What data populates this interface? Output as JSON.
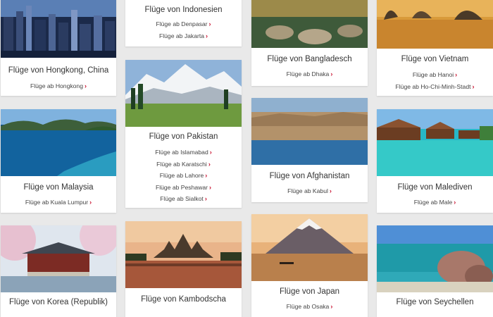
{
  "accent_color": "#c8102e",
  "cards": {
    "hongkong": {
      "title": "Flüge von Hongkong, China",
      "links": [
        {
          "label": "Flüge ab Hongkong",
          "icon": "chevron-right-icon"
        }
      ]
    },
    "indonesien": {
      "title": "Flüge von Indonesien",
      "links": [
        {
          "label": "Flüge ab Denpasar",
          "icon": "chevron-right-icon"
        },
        {
          "label": "Flüge ab Jakarta",
          "icon": "chevron-right-icon"
        }
      ]
    },
    "bangladesch": {
      "title": "Flüge von Bangladesch",
      "links": [
        {
          "label": "Flüge ab Dhaka",
          "icon": "chevron-right-icon"
        }
      ]
    },
    "vietnam": {
      "title": "Flüge von Vietnam",
      "links": [
        {
          "label": "Flüge ab Hanoi",
          "icon": "chevron-right-icon"
        },
        {
          "label": "Flüge ab Ho-Chi-Minh-Stadt",
          "icon": "chevron-right-icon"
        }
      ]
    },
    "malaysia": {
      "title": "Flüge von Malaysia",
      "links": [
        {
          "label": "Flüge ab Kuala Lumpur",
          "icon": "chevron-right-icon"
        }
      ]
    },
    "pakistan": {
      "title": "Flüge von Pakistan",
      "links": [
        {
          "label": "Flüge ab Islamabad",
          "icon": "chevron-right-icon"
        },
        {
          "label": "Flüge ab Karatschi",
          "icon": "chevron-right-icon"
        },
        {
          "label": "Flüge ab Lahore",
          "icon": "chevron-right-icon"
        },
        {
          "label": "Flüge ab Peshawar",
          "icon": "chevron-right-icon"
        },
        {
          "label": "Flüge ab Sialkot",
          "icon": "chevron-right-icon"
        }
      ]
    },
    "afghanistan": {
      "title": "Flüge von Afghanistan",
      "links": [
        {
          "label": "Flüge ab Kabul",
          "icon": "chevron-right-icon"
        }
      ]
    },
    "malediven": {
      "title": "Flüge von Malediven",
      "links": [
        {
          "label": "Flüge ab Male",
          "icon": "chevron-right-icon"
        }
      ]
    },
    "korea": {
      "title": "Flüge von Korea (Republik)",
      "links": []
    },
    "kambodscha": {
      "title": "Flüge von Kambodscha",
      "links": []
    },
    "japan": {
      "title": "Flüge von Japan",
      "links": [
        {
          "label": "Flüge ab Osaka",
          "icon": "chevron-right-icon"
        }
      ]
    },
    "seychellen": {
      "title": "Flüge von Seychellen",
      "links": []
    }
  }
}
